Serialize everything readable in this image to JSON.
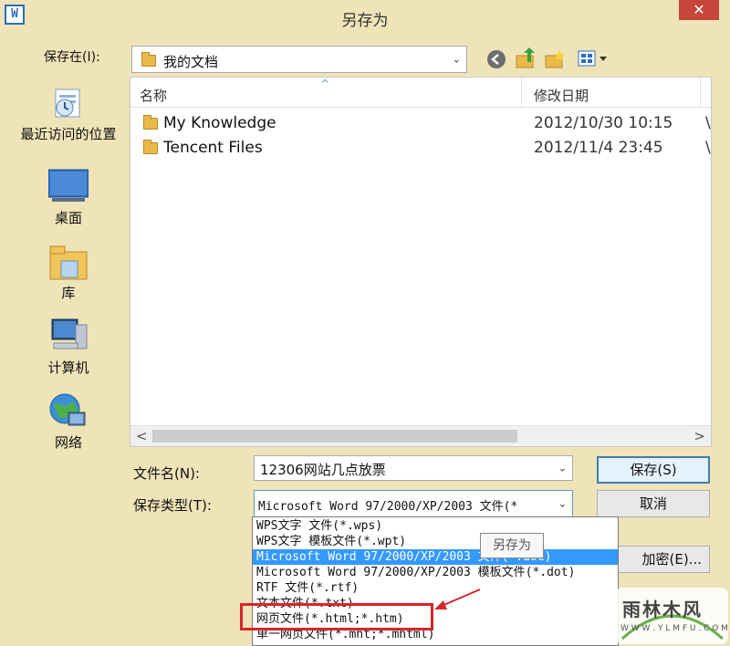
{
  "window": {
    "title": "另存为",
    "close_glyph": "✕"
  },
  "save_in": {
    "label": "保存在(I):",
    "value": "我的文档",
    "arrow": "⌄"
  },
  "toolbar": {
    "back_icon": "back-icon",
    "up_icon": "up-folder-icon",
    "newfolder_icon": "new-folder-icon",
    "views_icon": "views-menu-icon"
  },
  "places": [
    {
      "label": "最近访问的位置",
      "icon": "recent-places-icon"
    },
    {
      "label": "桌面",
      "icon": "desktop-icon"
    },
    {
      "label": "库",
      "icon": "libraries-icon"
    },
    {
      "label": "计算机",
      "icon": "computer-icon"
    },
    {
      "label": "网络",
      "icon": "network-icon"
    }
  ],
  "file_list": {
    "columns": [
      "名称",
      "修改日期"
    ],
    "sort_glyph": "^",
    "rows": [
      {
        "name": "My Knowledge",
        "date": "2012/10/30 10:15",
        "more": "\\"
      },
      {
        "name": "Tencent Files",
        "date": "2012/11/4 23:45",
        "more": "\\"
      }
    ],
    "scroll_left": "<",
    "scroll_right": ">"
  },
  "filename": {
    "label": "文件名(N):",
    "value": "12306网站几点放票",
    "arrow": "⌄"
  },
  "filetype": {
    "label": "保存类型(T):",
    "value": "Microsoft Word 97/2000/XP/2003 文件(*",
    "arrow": "⌄"
  },
  "buttons": {
    "save": "保存(S)",
    "cancel": "取消",
    "encrypt": "加密(E)..."
  },
  "dropdown_options": [
    "WPS文字 文件(*.wps)",
    "WPS文字 模板文件(*.wpt)",
    "Microsoft Word 97/2000/XP/2003 文件(*.doc)",
    "Microsoft Word 97/2000/XP/2003 模板文件(*.dot)",
    "RTF 文件(*.rtf)",
    "文本文件(*.txt)",
    "网页文件(*.html;*.htm)",
    "单一网页文件(*.mht;*.mhtml)"
  ],
  "selected_option_index": 2,
  "tooltip": "另存为",
  "watermark": {
    "brand": "雨林木风",
    "url": "W W W . Y L M F U . C O M"
  },
  "colors": {
    "window_bg": "#efe3b8",
    "selection": "#3399ff",
    "highlight": "#d8252c",
    "close": "#c7453a"
  }
}
